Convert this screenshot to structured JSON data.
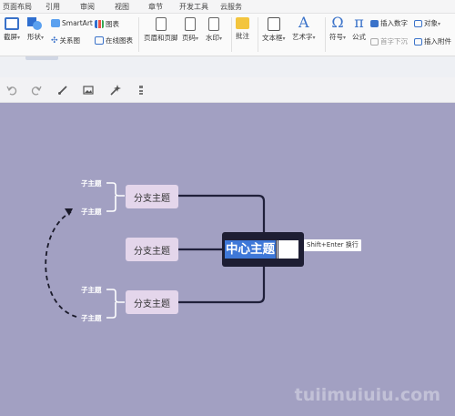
{
  "ribbon_tabs": [
    "页面布局",
    "引用",
    "审阅",
    "视图",
    "章节",
    "开发工具",
    "云服务"
  ],
  "ribbon": {
    "screenshot": "截屏",
    "shape": "形状",
    "smartart": "SmartArt",
    "relation": "关系图",
    "chart": "图表",
    "online_chart": "在线图表",
    "header_footer": "页眉和页脚",
    "page_number": "页码",
    "watermark": "水印",
    "comment": "批注",
    "textbox": "文本框",
    "wordart": "艺术字",
    "symbol": "符号",
    "formula": "公式",
    "insert_number": "插入数字",
    "object": "对象",
    "first_sink": "首字下沉",
    "insert_attachment": "插入附件"
  },
  "mindmap_toolbar": {
    "icons": [
      "undo-icon",
      "redo-icon",
      "brush-icon",
      "image-icon",
      "magic-wand-icon",
      "align-icon"
    ]
  },
  "mindmap": {
    "center_text": "中心主题",
    "hint": "Shift+Enter 换行",
    "branches": [
      "分支主题",
      "分支主题",
      "分支主题"
    ],
    "subtopics": [
      "子主题",
      "子主题",
      "子主题",
      "子主题"
    ]
  },
  "watermark": "tuiimuiuiu.com",
  "colors": {
    "canvas": "#a2a0c2",
    "branch_fill": "#e4d6eb",
    "center_fill": "#1e1e33",
    "selection": "#3f78d8"
  }
}
